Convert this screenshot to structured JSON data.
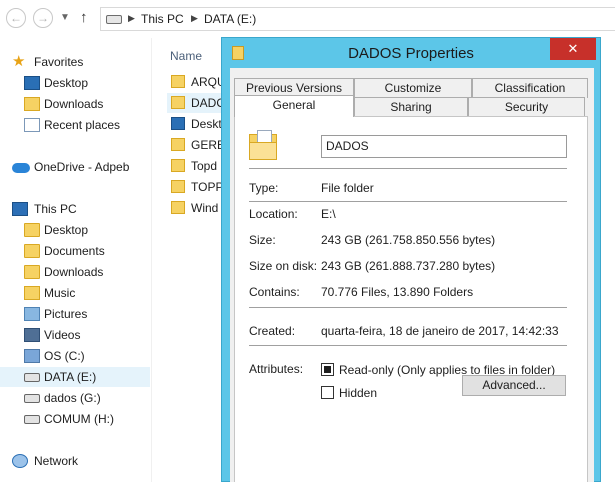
{
  "address": {
    "crumbs": [
      "This PC",
      "DATA (E:)"
    ]
  },
  "icons": {
    "back": "back-arrow-icon",
    "forward": "forward-arrow-icon",
    "up": "up-arrow-icon",
    "drive": "drive-icon",
    "folder": "folder-icon",
    "star": "star-icon",
    "cloud": "onedrive-cloud-icon",
    "computer": "computer-icon",
    "network": "network-icon"
  },
  "nav": {
    "favorites": "Favorites",
    "desktop_fav": "Desktop",
    "downloads_fav": "Downloads",
    "recent": "Recent places",
    "onedrive": "OneDrive - Adpeb",
    "thispc": "This PC",
    "desktop": "Desktop",
    "documents": "Documents",
    "downloads": "Downloads",
    "music": "Music",
    "pictures": "Pictures",
    "videos": "Videos",
    "os_c": "OS (C:)",
    "data_e": "DATA (E:)",
    "dados_g": "dados (G:)",
    "comum_h": "COMUM (H:)",
    "network": "Network"
  },
  "files": {
    "column_name": "Name",
    "items": [
      "ARQU",
      "DADO",
      "Deskt",
      "GERE",
      "Topd",
      "TOPP",
      "Wind"
    ]
  },
  "dialog": {
    "title": "DADOS Properties",
    "close": "✕",
    "tabs": {
      "previous_versions": "Previous Versions",
      "customize": "Customize",
      "classification": "Classification",
      "general": "General",
      "sharing": "Sharing",
      "security": "Security"
    },
    "name_value": "DADOS",
    "type_label": "Type:",
    "type_value": "File folder",
    "location_label": "Location:",
    "location_value": "E:\\",
    "size_label": "Size:",
    "size_value": "243 GB (261.758.850.556 bytes)",
    "size_on_disk_label": "Size on disk:",
    "size_on_disk_value": "243 GB (261.888.737.280 bytes)",
    "contains_label": "Contains:",
    "contains_value": "70.776 Files, 13.890 Folders",
    "created_label": "Created:",
    "created_value": "quarta-feira, 18 de janeiro de 2017, 14:42:33",
    "attributes_label": "Attributes:",
    "readonly_label": "Read-only (Only applies to files in folder)",
    "hidden_label": "Hidden",
    "advanced_button": "Advanced..."
  },
  "colors": {
    "dialog_frame": "#5cc6e8",
    "close_button": "#c7302a",
    "selection": "#e5f3fb",
    "folder": "#f6d263"
  }
}
